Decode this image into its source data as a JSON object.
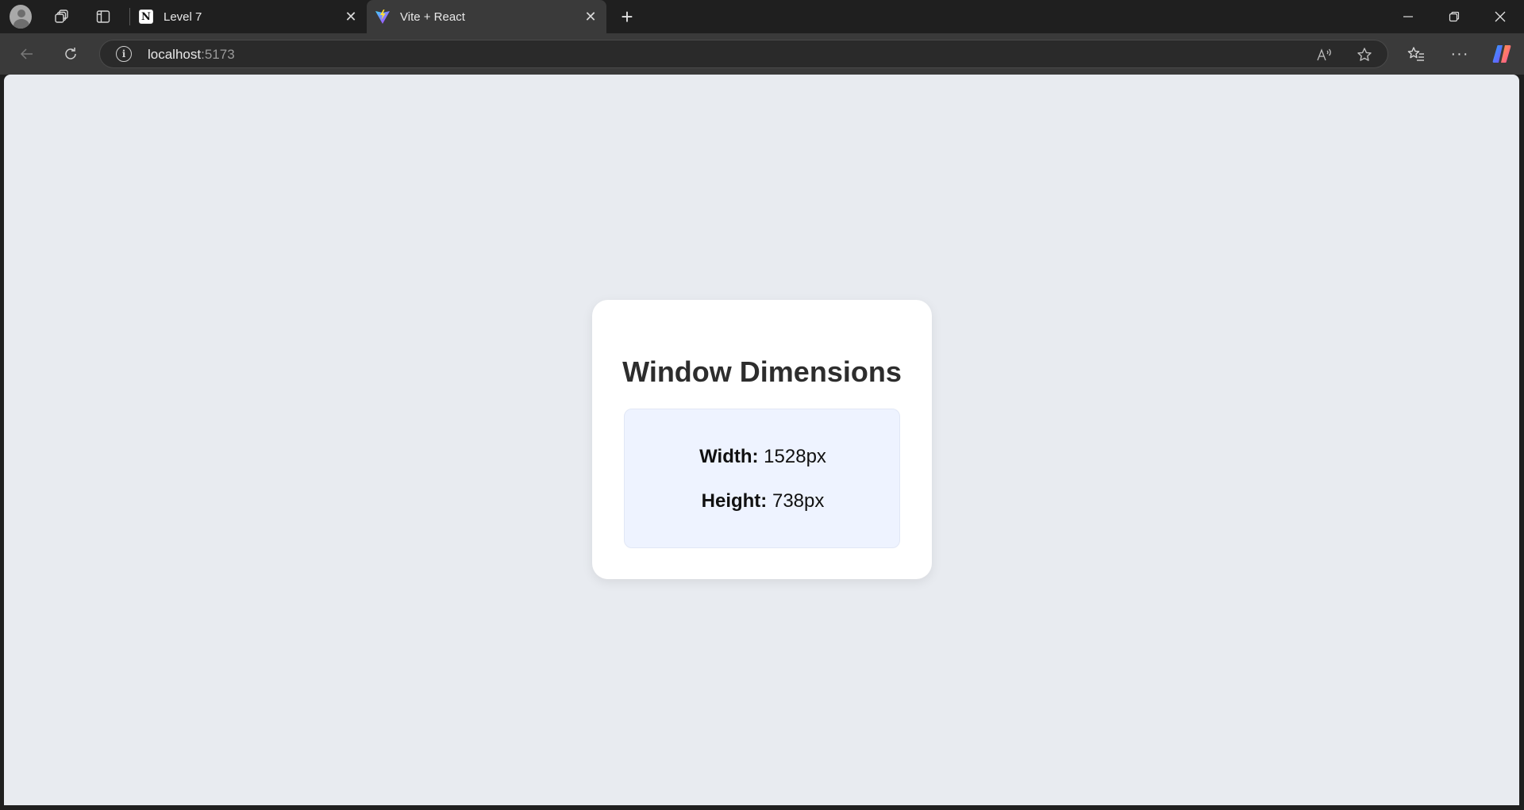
{
  "browser": {
    "tabs": [
      {
        "label": "Level 7",
        "favicon": "notion-icon",
        "active": false
      },
      {
        "label": "Vite + React",
        "favicon": "vite-icon",
        "active": true
      }
    ],
    "address": {
      "host": "localhost",
      "port": ":5173"
    }
  },
  "page": {
    "title": "Window Dimensions",
    "width_label": "Width:",
    "width_value": "1528px",
    "height_label": "Height:",
    "height_value": "738px"
  },
  "colors": {
    "page_background": "#e8ebf0",
    "card_background": "#ffffff",
    "dims_box_background": "#eef3ff",
    "title_text": "#2d2d2d"
  }
}
